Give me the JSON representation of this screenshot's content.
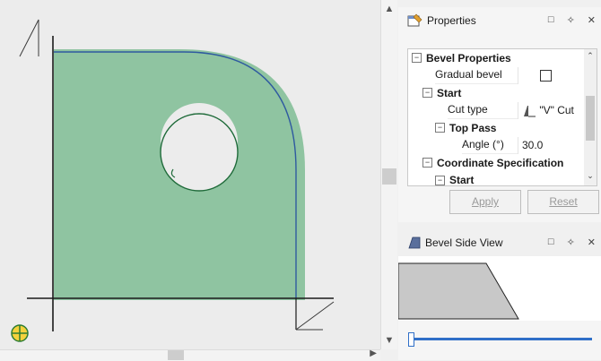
{
  "properties_panel": {
    "title": "Properties",
    "rows": [
      {
        "type": "group",
        "label": "Bevel Properties",
        "indent": 0
      },
      {
        "type": "prop",
        "label": "Gradual bevel",
        "value": ""
      },
      {
        "type": "group",
        "label": "Start",
        "indent": 1
      },
      {
        "type": "prop",
        "label": "Cut type",
        "value": "\"V\" Cut"
      },
      {
        "type": "group",
        "label": "Top Pass",
        "indent": 2
      },
      {
        "type": "prop",
        "label": "Angle (°)",
        "value": "30.0"
      },
      {
        "type": "group",
        "label": "Coordinate Specification",
        "indent": 1
      },
      {
        "type": "group",
        "label": "Start",
        "indent": 2
      }
    ],
    "apply_label": "Apply",
    "reset_label": "Reset"
  },
  "side_view_panel": {
    "title": "Bevel Side View"
  },
  "colors": {
    "part_fill": "#8fc4a1",
    "part_outline": "#2f5aa0",
    "slider": "#2f6fc8"
  }
}
